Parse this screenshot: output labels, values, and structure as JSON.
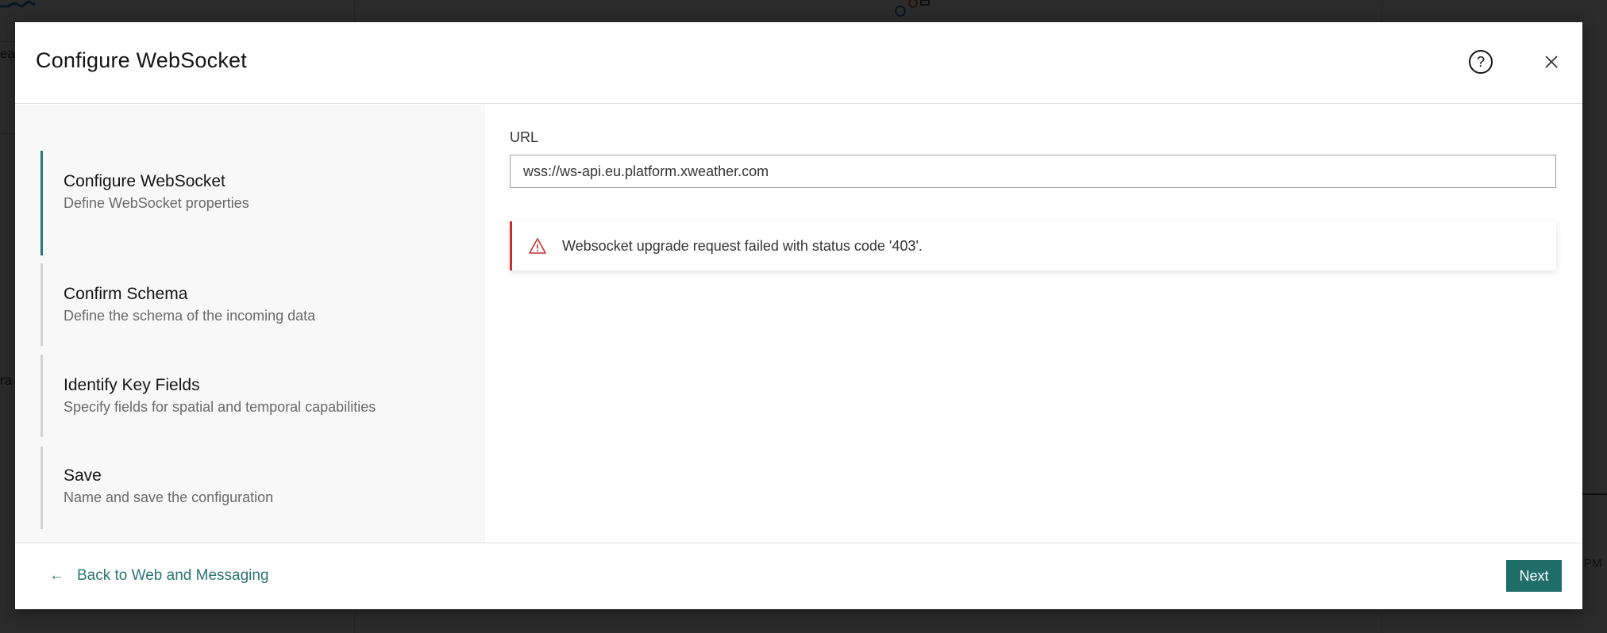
{
  "background": {
    "left_text_1": "ea",
    "left_text_2": "ra",
    "right_text": "PM"
  },
  "modal": {
    "title": "Configure WebSocket",
    "help_glyph": "?",
    "help_icon": "help-circle-icon",
    "close_icon": "close-icon"
  },
  "steps": [
    {
      "title": "Configure WebSocket",
      "description": "Define WebSocket properties",
      "active": true
    },
    {
      "title": "Confirm Schema",
      "description": "Define the schema of the incoming data",
      "active": false
    },
    {
      "title": "Identify Key Fields",
      "description": "Specify fields for spatial and temporal capabilities",
      "active": false
    },
    {
      "title": "Save",
      "description": "Name and save the configuration",
      "active": false
    }
  ],
  "form": {
    "url_label": "URL",
    "url_value": "wss://ws-api.eu.platform.xweather.com"
  },
  "error": {
    "icon": "warning-triangle-icon",
    "message": "Websocket upgrade request failed with status code '403'.",
    "color": "#c82f2f"
  },
  "footer": {
    "back_arrow": "←",
    "back_label": "Back to Web and Messaging",
    "next_label": "Next"
  },
  "colors": {
    "accent": "#2a7672",
    "button": "#1f6e6a"
  }
}
